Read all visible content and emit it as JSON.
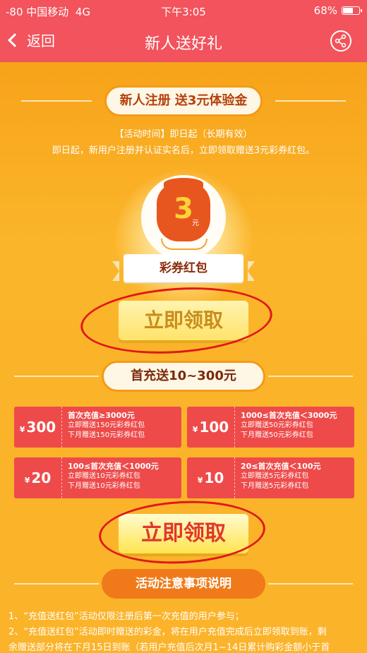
{
  "status_bar": {
    "signal": "-80 中国移动",
    "network": "4G",
    "time": "下午3:05",
    "battery": "68%",
    "battery_level": 0.68
  },
  "nav": {
    "back_label": "返回",
    "title": "新人送好礼",
    "share_icon": "share-icon"
  },
  "section1": {
    "title": "新人注册 送3元体验金",
    "time_line": "【活动时间】即日起（长期有效）",
    "desc_line": "即日起，新用户注册并认证实名后，立即领取赠送3元彩券红包。",
    "bag_amount": "3",
    "bag_unit": "元",
    "ribbon_label": "彩券红包",
    "claim_label": "立即领取"
  },
  "section2": {
    "title": "首充送10~300元",
    "tickets": [
      {
        "currency": "¥",
        "amount": "300",
        "title": "首次充值≥3000元",
        "line1": "立即赠送150元彩券红包",
        "line2": "下月赠送150元彩券红包"
      },
      {
        "currency": "¥",
        "amount": "100",
        "title": "1000≤首次充值＜3000元",
        "line1": "立即赠送50元彩券红包",
        "line2": "下月赠送50元彩券红包"
      },
      {
        "currency": "¥",
        "amount": "20",
        "title": "100≤首次充值＜1000元",
        "line1": "立即赠送10元彩券红包",
        "line2": "下月赠送10元彩券红包"
      },
      {
        "currency": "¥",
        "amount": "10",
        "title": "20≤首次充值＜100元",
        "line1": "立即赠送5元彩券红包",
        "line2": "下月赠送5元彩券红包"
      }
    ],
    "claim_label": "立即领取"
  },
  "section3": {
    "title": "活动注意事项说明",
    "notes": [
      "1、“充值送红包”活动仅限注册后第一次充值的用户参与；",
      "2、“充值送红包”活动即时赠送的彩金，将在用户充值完成后立即领取到账，剩",
      "余赠送部分将在下月15日到账（若用户充值后次月1~14日累计购彩金额小于首"
    ]
  },
  "colors": {
    "nav_bg": "#f2535c",
    "page_bg": "#fbb52a",
    "ticket_bg": "#ee4a4a",
    "annotation": "#e01818"
  }
}
